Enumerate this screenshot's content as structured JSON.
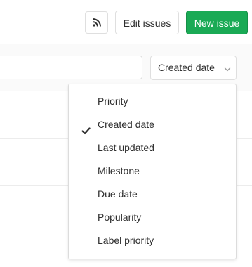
{
  "header": {
    "rss_icon": "rss-icon",
    "edit_issues_label": "Edit issues",
    "new_issue_label": "New issue",
    "new_issue_color": "#1aaa55"
  },
  "filter": {
    "search_value": "",
    "sort_selected": "Created date",
    "sort_icon": "chevron-down-icon"
  },
  "sort_menu": {
    "items": [
      {
        "label": "Priority",
        "checked": false
      },
      {
        "label": "Created date",
        "checked": true
      },
      {
        "label": "Last updated",
        "checked": false
      },
      {
        "label": "Milestone",
        "checked": false
      },
      {
        "label": "Due date",
        "checked": false
      },
      {
        "label": "Popularity",
        "checked": false
      },
      {
        "label": "Label priority",
        "checked": false
      }
    ],
    "check_icon": "checkmark-icon"
  }
}
